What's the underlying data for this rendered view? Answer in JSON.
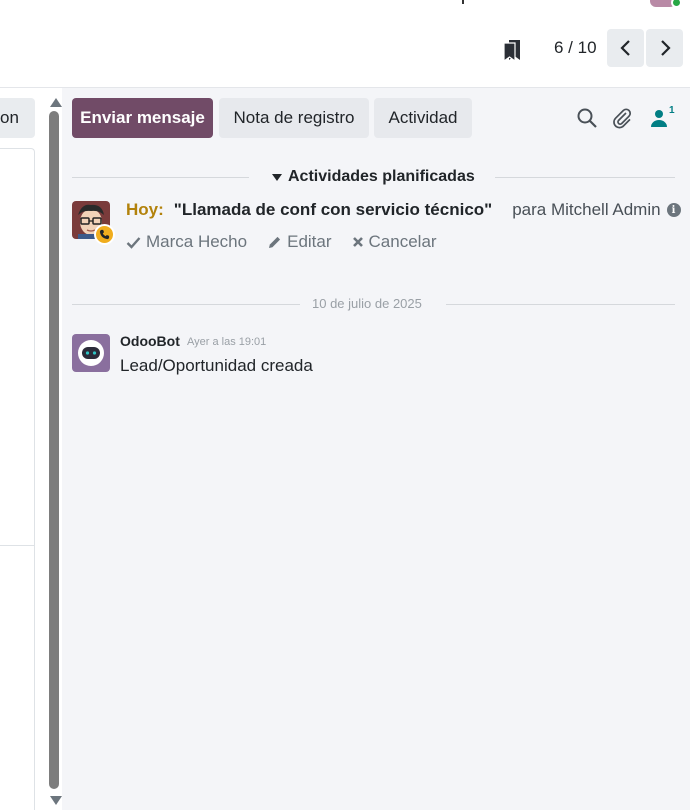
{
  "header": {
    "pager_value": "6 / 10",
    "prev_icon": "chevron-left-icon",
    "next_icon": "chevron-right-icon",
    "bookmark_icon": "bookmark-icon"
  },
  "form": {
    "left_button_label": "on"
  },
  "chatter": {
    "send_message_label": "Enviar mensaje",
    "log_note_label": "Nota de registro",
    "activity_label": "Actividad",
    "follower_count": "1",
    "colors": {
      "accent": "#714b67",
      "today": "#b2820c",
      "follower": "#017e84"
    }
  },
  "activities": {
    "section_title": "Actividades planificadas",
    "items": [
      {
        "due": "Hoy:",
        "summary": "\"Llamada de conf con servicio técnico\"",
        "assignee": "para Mitchell Admin",
        "actions": {
          "done": "Marca Hecho",
          "edit": "Editar",
          "cancel": "Cancelar"
        }
      }
    ]
  },
  "messages": {
    "date_separator": "10 de julio de 2025",
    "items": [
      {
        "author": "OdooBot",
        "date": "Ayer a las 19:01",
        "body": "Lead/Oportunidad creada"
      }
    ]
  }
}
